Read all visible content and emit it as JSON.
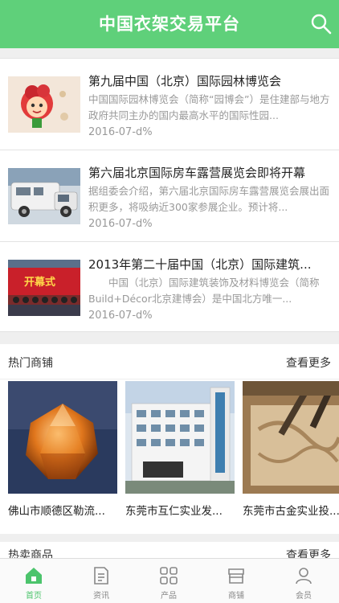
{
  "header": {
    "title": "中国衣架交易平台"
  },
  "news": [
    {
      "title": "第九届中国（北京）国际园林博览会",
      "desc": "中国国际园林博览会（简称“园博会”）是住建部与地方政府共同主办的国内最高水平的国际性园...",
      "date": "2016-07-d%"
    },
    {
      "title": "第六届北京国际房车露营展览会即将开幕",
      "desc": "据组委会介绍，第六届北京国际房车露营展览会展出面积更多，将吸纳近300家参展企业。预计将...",
      "date": "2016-07-d%"
    },
    {
      "title": "2013年第二十届中国（北京）国际建筑...",
      "desc": "　　中国（北京）国际建筑装饰及材料博览会（简称Build+Décor北京建博会）是中国北方唯一...",
      "date": "2016-07-d%"
    }
  ],
  "shops": {
    "title": "热门商铺",
    "more": "查看更多",
    "items": [
      {
        "name": "佛山市顺德区勒流..."
      },
      {
        "name": "东莞市互仁实业发..."
      },
      {
        "name": "东莞市古金实业投..."
      }
    ]
  },
  "hot_products": {
    "title": "热卖商品",
    "more": "查看更多"
  },
  "tabbar": {
    "tabs": [
      {
        "label": "首页",
        "icon": "home-icon"
      },
      {
        "label": "资讯",
        "icon": "document-icon"
      },
      {
        "label": "产品",
        "icon": "grid-icon"
      },
      {
        "label": "商铺",
        "icon": "store-icon"
      },
      {
        "label": "会员",
        "icon": "user-icon"
      }
    ]
  },
  "colors": {
    "brand": "#5fd07a",
    "active_tab": "#4cc46c",
    "muted_text": "#999999"
  }
}
